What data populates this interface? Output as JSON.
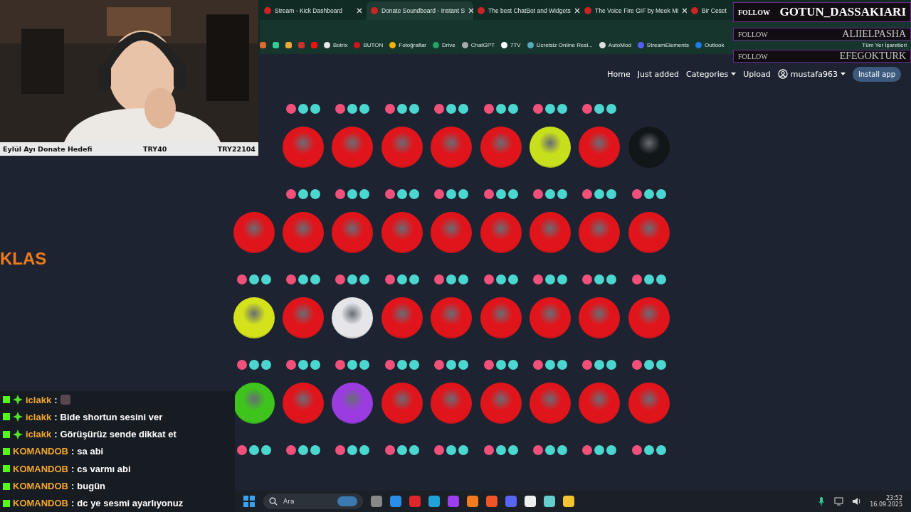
{
  "browser": {
    "tabs": [
      {
        "title": "Stream - Kick Dashboard",
        "selected": false
      },
      {
        "title": "Donate Soundboard - Instant S",
        "selected": true
      },
      {
        "title": "The best ChatBot and Widgets",
        "selected": false
      },
      {
        "title": "The Voice Fire GIF by Meek Mi",
        "selected": false
      },
      {
        "title": "Bir Ceset",
        "selected": false
      }
    ],
    "bookmarks": [
      "Botrix",
      "BUTON",
      "Fotoğraflar",
      "Drive",
      "ChatGPT",
      "7TV",
      "Ücretsiz Online Resi...",
      "AutoMod",
      "StreamElements",
      "Outlook"
    ],
    "all_bookmarks": "Tüm Yer İşaretleri"
  },
  "site_nav": {
    "links": [
      {
        "label": "Home",
        "dropdown": false
      },
      {
        "label": "Just added",
        "dropdown": false
      },
      {
        "label": "Categories",
        "dropdown": true
      },
      {
        "label": "Upload",
        "dropdown": false
      }
    ],
    "user": "mustafa963",
    "install": "Install app"
  },
  "soundboard": {
    "rows": [
      {
        "buttons": [
          {
            "color": "#e0151b"
          },
          {
            "color": "#e0151b"
          },
          {
            "color": "#e0151b"
          },
          {
            "color": "#e0151b"
          },
          {
            "color": "#e0151b"
          },
          {
            "color": "#c8e01c"
          },
          {
            "color": "#e0151b"
          },
          {
            "color": "#111618"
          }
        ]
      },
      {
        "buttons": [
          {
            "color": "#e0151b"
          },
          {
            "color": "#e0151b"
          },
          {
            "color": "#e0151b"
          },
          {
            "color": "#e0151b"
          },
          {
            "color": "#e0151b"
          },
          {
            "color": "#e0151b"
          },
          {
            "color": "#e0151b"
          },
          {
            "color": "#e0151b"
          },
          {
            "color": "#e0151b"
          }
        ]
      },
      {
        "buttons": [
          {
            "color": "#d4e21c"
          },
          {
            "color": "#e0151b"
          },
          {
            "color": "#e6e6ea"
          },
          {
            "color": "#e0151b"
          },
          {
            "color": "#e0151b"
          },
          {
            "color": "#e0151b"
          },
          {
            "color": "#e0151b"
          },
          {
            "color": "#e0151b"
          },
          {
            "color": "#e0151b"
          }
        ]
      },
      {
        "buttons": [
          {
            "color": "#3ec41c"
          },
          {
            "color": "#e0151b"
          },
          {
            "color": "#9a3ce0"
          },
          {
            "color": "#e0151b"
          },
          {
            "color": "#e0151b"
          },
          {
            "color": "#e0151b"
          },
          {
            "color": "#e0151b"
          },
          {
            "color": "#e0151b"
          },
          {
            "color": "#e0151b"
          }
        ]
      }
    ]
  },
  "stream_overlay": {
    "donation_goal": {
      "label": "Eylül Ayı Donate Hedefi",
      "current": "TRY40",
      "target": "TRY22104"
    },
    "brand": "KLAS",
    "follows": [
      {
        "label": "FOLLOW",
        "name": "GOTUN_DASSAKIARI",
        "kind": "latest"
      },
      {
        "label": "FOLLOW",
        "name": "ALIIELPASHA",
        "kind": "recent"
      },
      {
        "label": "FOLLOW",
        "name": "EFEGOKTURK",
        "kind": "recent"
      }
    ],
    "chat": [
      {
        "user": "iclakk",
        "separator": ":",
        "badge": true,
        "kind": "emote"
      },
      {
        "user": "iclakk",
        "separator": ":",
        "badge": true,
        "kind": "text",
        "message": "Bide shortun sesini ver"
      },
      {
        "user": "iclakk",
        "separator": ":",
        "badge": true,
        "kind": "text",
        "message": "Görüşürüz sende dikkat et"
      },
      {
        "user": "KOMANDOB",
        "separator": ":",
        "badge": false,
        "kind": "text",
        "message": "sa abi"
      },
      {
        "user": "KOMANDOB",
        "separator": ":",
        "badge": false,
        "kind": "text",
        "message": "cs varmı abi"
      },
      {
        "user": "KOMANDOB",
        "separator": ":",
        "badge": false,
        "kind": "text",
        "message": "bugün"
      },
      {
        "user": "KOMANDOB",
        "separator": ":",
        "badge": false,
        "kind": "text",
        "message": "dc ye sesmi ayarlıyonuz"
      }
    ]
  },
  "taskbar": {
    "search": "Ara",
    "time": "23:52",
    "date": "16.09.2025"
  }
}
